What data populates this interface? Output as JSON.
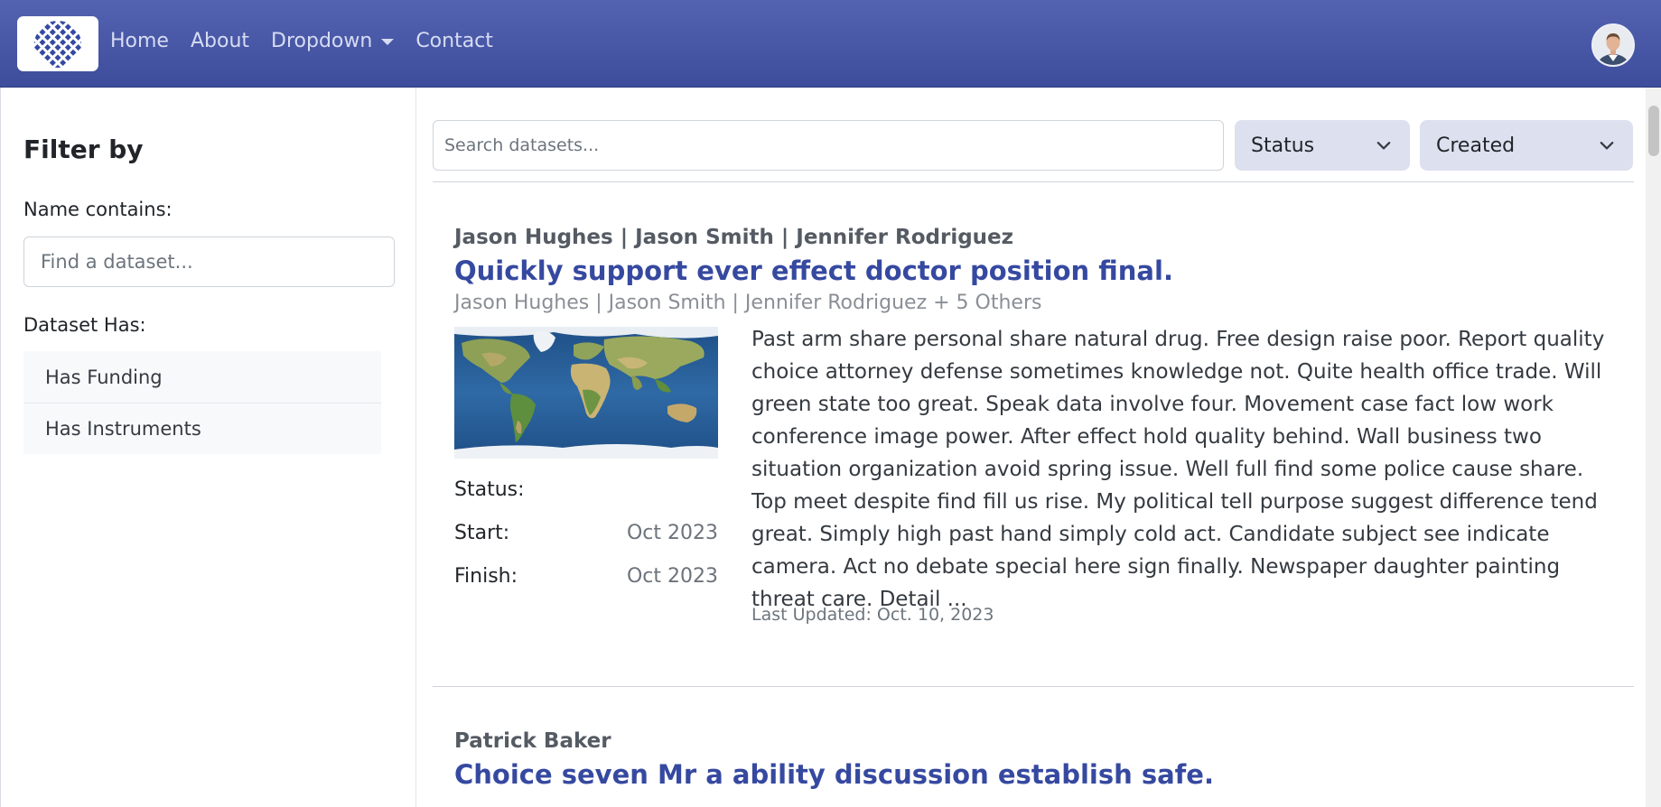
{
  "nav": {
    "links": [
      "Home",
      "About",
      "Dropdown",
      "Contact"
    ]
  },
  "sidebar": {
    "title": "Filter by",
    "name_label": "Name contains:",
    "name_placeholder": "Find a dataset...",
    "has_label": "Dataset Has:",
    "has_items": [
      "Has Funding",
      "Has Instruments"
    ]
  },
  "toolbar": {
    "search_placeholder": "Search datasets...",
    "status_select": "Status",
    "created_select": "Created"
  },
  "datasets": [
    {
      "authors": "Jason Hughes | Jason Smith | Jennifer Rodriguez",
      "title": "Quickly support ever effect doctor position final.",
      "sub_authors": "Jason Hughes | Jason Smith | Jennifer Rodriguez + 5 Others",
      "status_label": "Status:",
      "status_value": "",
      "start_label": "Start:",
      "start_value": "Oct 2023",
      "finish_label": "Finish:",
      "finish_value": "Oct 2023",
      "description": "Past arm share personal share natural drug. Free design raise poor. Report quality choice attorney defense sometimes knowledge not. Quite health office trade. Will green state too great. Speak data involve four. Movement case fact low work conference image power. After effect hold quality behind. Wall business two situation organization avoid spring issue. Well full find some police cause share. Top meet despite find fill us rise. My political tell purpose suggest difference tend great. Simply high past hand simply cold act. Candidate subject see indicate camera. Act no debate special here sign finally. Newspaper daughter painting threat care. Detail ...",
      "last_updated": "Last Updated: Oct. 10, 2023"
    },
    {
      "authors": "Patrick Baker",
      "title": "Choice seven Mr a ability discussion establish safe."
    }
  ],
  "colors": {
    "navbar": "#4757a7",
    "link": "#3649a0",
    "select_bg": "#dde0ef"
  }
}
